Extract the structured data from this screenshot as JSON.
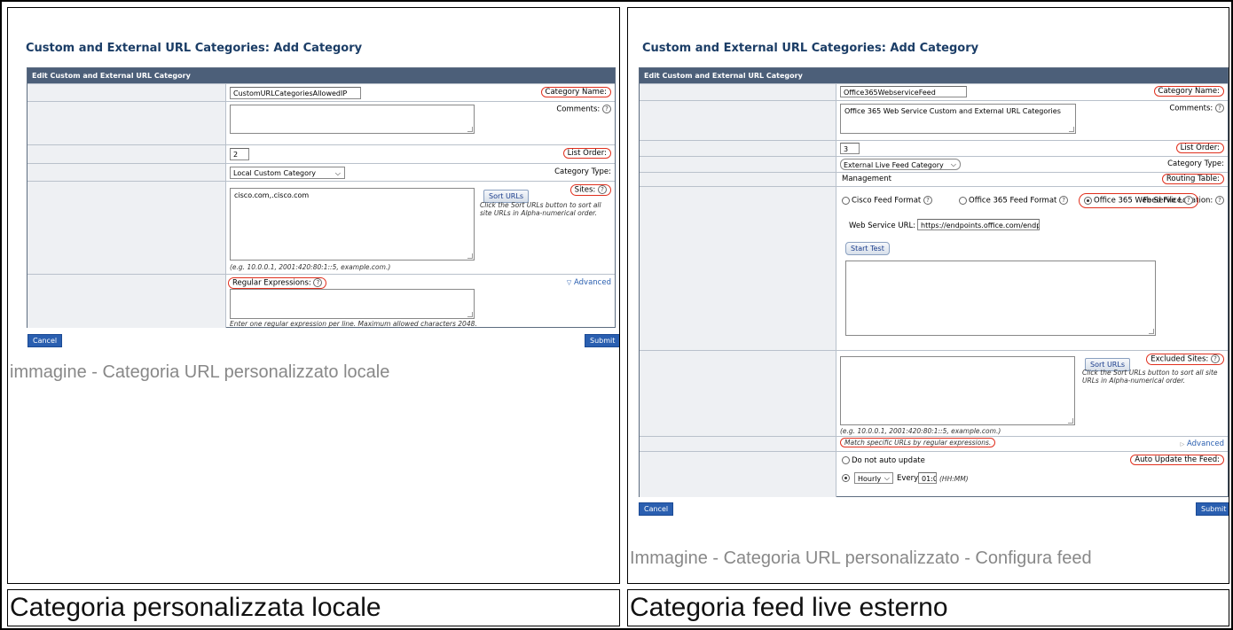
{
  "left": {
    "title": "Custom and External URL Categories: Add Category",
    "panel_header": "Edit Custom and External URL Category",
    "category_name_label": "Category Name:",
    "category_name_value": "CustomURLCategoriesAllowedIP",
    "comments_label": "Comments:",
    "list_order_label": "List Order:",
    "list_order_value": "2",
    "category_type_label": "Category Type:",
    "category_type_value": "Local Custom Category",
    "sites_label": "Sites:",
    "sites_value": "cisco.com,.cisco.com",
    "sort_urls_label": "Sort URLs",
    "sort_urls_hint": "Click the Sort URLs button to sort all site URLs in Alpha-numerical order.",
    "sites_example": "(e.g. 10.0.0.1, 2001:420:80:1::5, example.com.)",
    "advanced_label": "Advanced",
    "regex_label": "Regular Expressions:",
    "regex_hint": "Enter one regular expression per line. Maximum allowed characters 2048.",
    "cancel_label": "Cancel",
    "submit_label": "Submit",
    "image_caption": "immagine - Categoria URL personalizzato locale",
    "cell_caption": "Categoria personalizzata locale"
  },
  "right": {
    "title": "Custom and External URL Categories: Add Category",
    "panel_header": "Edit Custom and External URL Category",
    "category_name_label": "Category Name:",
    "category_name_value": "Office365WebserviceFeed",
    "comments_label": "Comments:",
    "comments_value": "Office 365 Web Service Custom and External URL Categories",
    "list_order_label": "List Order:",
    "list_order_value": "3",
    "category_type_label": "Category Type:",
    "category_type_value": "External Live Feed Category",
    "routing_table_label": "Routing Table:",
    "routing_table_value": "Management",
    "feed_location_label": "Feed File Location:",
    "feed_options": [
      "Cisco Feed Format",
      "Office 365 Feed Format",
      "Office 365 Web Service"
    ],
    "web_service_url_label": "Web Service URL:",
    "web_service_url_value": "https://endpoints.office.com/endpoi",
    "start_test_label": "Start Test",
    "excluded_sites_label": "Excluded Sites:",
    "sort_urls_label": "Sort URLs",
    "sort_urls_hint": "Click the Sort URLs button to sort all site URLs in Alpha-numerical order.",
    "sites_example": "(e.g. 10.0.0.1, 2001:420:80:1::5, example.com.)",
    "advanced_label": "Advanced",
    "advanced_hint": "Match specific URLs by regular expressions.",
    "auto_update_label": "Auto Update the Feed:",
    "no_auto_update_label": "Do not auto update",
    "frequency_value": "Hourly",
    "every_label": "Every",
    "every_value": "01:0",
    "time_format_hint": "(HH:MM)",
    "cancel_label": "Cancel",
    "submit_label": "Submit",
    "image_caption": "Immagine - Categoria URL personalizzato - Configura feed",
    "cell_caption": "Categoria feed live esterno"
  },
  "help_glyph": "?"
}
